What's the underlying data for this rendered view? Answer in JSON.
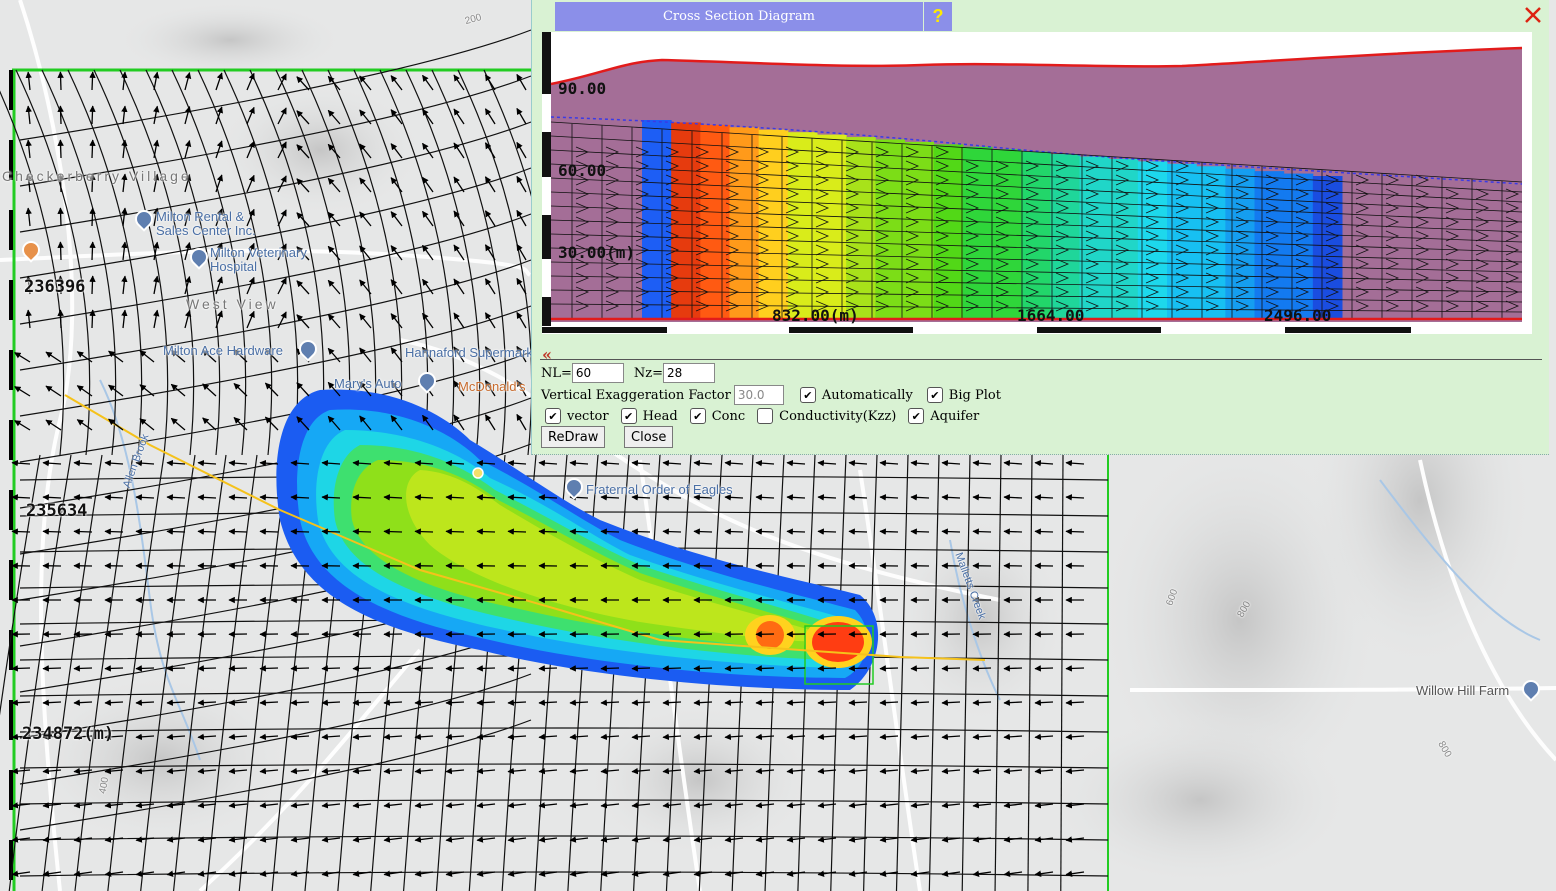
{
  "map": {
    "places": {
      "village": "Checkerberry Village",
      "rental": "Milton Rental & Sales Center Inc.",
      "vet": "Milton Veterinary Hospital",
      "westview": "West View",
      "hardware": "Milton Ace Hardware",
      "hannaford": "Hannaford Supermarket",
      "marys": "Mary's Auto",
      "mcd": "McDonald's",
      "eagles": "Fraternal Order of Eagles",
      "willow": "Willow Hill Farm",
      "allen": "Allen Brook",
      "mallets": "Malletts Creek",
      "contour_200": "200",
      "contour_400": "400",
      "contour_600": "600",
      "contour_800a": "800",
      "contour_800b": "800"
    },
    "coords": {
      "y1": "236396",
      "y2": "235634",
      "y3": "234872(m)"
    }
  },
  "panel": {
    "title": "Cross Section Diagram",
    "help": "?",
    "collapse_glyph": "«",
    "plot": {
      "y_labels": [
        "90.00",
        "60.00",
        "30.00(m)"
      ],
      "x_labels": [
        "832.00(m)",
        "1664.00",
        "2496.00"
      ]
    },
    "controls": {
      "nl_label": "NL=",
      "nl_value": "60",
      "nz_label": "Nz=",
      "nz_value": "28",
      "vef_label": "Vertical Exaggeration Factor",
      "vef_value": "30.0",
      "auto_label": "Automatically",
      "big_plot_label": "Big Plot",
      "vector_label": "vector",
      "head_label": "Head",
      "conc_label": "Conc",
      "kzz_label": "Conductivity(Kzz)",
      "aquifer_label": "Aquifer",
      "redraw": "ReDraw",
      "close": "Close"
    },
    "checkbox_states": {
      "auto": true,
      "big_plot": true,
      "vector": true,
      "head": true,
      "conc": true,
      "kzz": false,
      "aquifer": true
    }
  }
}
